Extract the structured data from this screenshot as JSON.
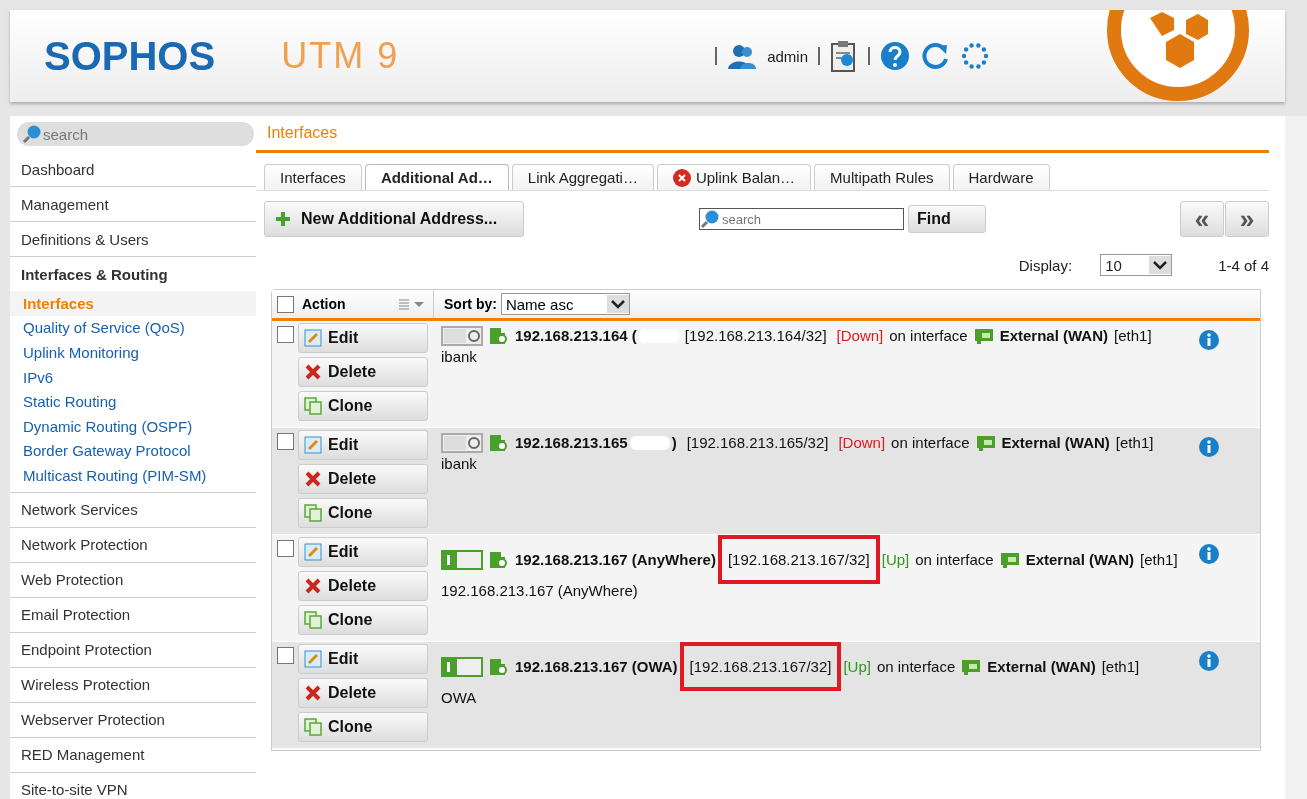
{
  "header": {
    "brand": "SOPHOS",
    "product": "UTM 9",
    "user": "admin"
  },
  "search": {
    "placeholder": "search"
  },
  "breadcrumb": "Interfaces",
  "sidebar": {
    "items": [
      {
        "label": "Dashboard"
      },
      {
        "label": "Management"
      },
      {
        "label": "Definitions & Users"
      },
      {
        "label": "Interfaces & Routing",
        "children": [
          {
            "label": "Interfaces",
            "selected": true
          },
          {
            "label": "Quality of Service (QoS)",
            "selected": false
          },
          {
            "label": "Uplink Monitoring",
            "selected": false
          },
          {
            "label": "IPv6",
            "selected": false
          },
          {
            "label": "Static Routing",
            "selected": false
          },
          {
            "label": "Dynamic Routing (OSPF)",
            "selected": false
          },
          {
            "label": "Border Gateway Protocol",
            "selected": false
          },
          {
            "label": "Multicast Routing (PIM-SM)",
            "selected": false
          }
        ]
      },
      {
        "label": "Network Services"
      },
      {
        "label": "Network Protection"
      },
      {
        "label": "Web Protection"
      },
      {
        "label": "Email Protection"
      },
      {
        "label": "Endpoint Protection"
      },
      {
        "label": "Wireless Protection"
      },
      {
        "label": "Webserver Protection"
      },
      {
        "label": "RED Management"
      },
      {
        "label": "Site-to-site VPN"
      }
    ]
  },
  "tabs": [
    {
      "label": "Interfaces",
      "selected": false,
      "error": false
    },
    {
      "label": "Additional Ad…",
      "selected": true,
      "error": false
    },
    {
      "label": "Link Aggregati…",
      "selected": false,
      "error": false
    },
    {
      "label": "Uplink Balan…",
      "selected": false,
      "error": true
    },
    {
      "label": "Multipath Rules",
      "selected": false,
      "error": false
    },
    {
      "label": "Hardware",
      "selected": false,
      "error": false
    }
  ],
  "toolbar": {
    "new_button": "New Additional Address...",
    "search_placeholder": "search",
    "find_button": "Find",
    "prev_button": "«",
    "next_button": "»"
  },
  "display": {
    "label": "Display:",
    "value": "10",
    "count": "1-4 of 4"
  },
  "table": {
    "action_header": "Action",
    "sort_label": "Sort by:",
    "sort_value": "Name asc",
    "all_checked": false,
    "rows": [
      {
        "actions": [
          "Edit",
          "Delete",
          "Clone"
        ],
        "checked": false,
        "on": false,
        "name": "192.168.213.164 (",
        "redacted": true,
        "address": "[192.168.213.164/32]",
        "status": "[Down]",
        "up": false,
        "highlighted": false,
        "on_text": "on interface",
        "interface": "External (WAN)",
        "port": "[eth1]",
        "comment": "ibank"
      },
      {
        "actions": [
          "Edit",
          "Delete",
          "Clone"
        ],
        "checked": false,
        "on": false,
        "name": "192.168.213.165",
        "redacted": true,
        "name_end": ")",
        "address": "[192.168.213.165/32]",
        "status": "[Down]",
        "up": false,
        "highlighted": false,
        "on_text": "on interface",
        "interface": "External (WAN)",
        "port": "[eth1]",
        "comment": "ibank"
      },
      {
        "actions": [
          "Edit",
          "Delete",
          "Clone"
        ],
        "checked": false,
        "on": true,
        "name": "192.168.213.167 (AnyWhere)",
        "redacted": false,
        "address": "[192.168.213.167/32]",
        "status": "[Up]",
        "up": true,
        "highlighted": true,
        "on_text": "on interface",
        "interface": "External (WAN)",
        "port": "[eth1]",
        "comment": "192.168.213.167 (AnyWhere)"
      },
      {
        "actions": [
          "Edit",
          "Delete",
          "Clone"
        ],
        "checked": false,
        "on": true,
        "name": "192.168.213.167 (OWA)",
        "redacted": false,
        "address": "[192.168.213.167/32]",
        "status": "[Up]",
        "up": true,
        "highlighted": true,
        "on_text": "on interface",
        "interface": "External (WAN)",
        "port": "[eth1]",
        "comment": "OWA"
      }
    ]
  }
}
